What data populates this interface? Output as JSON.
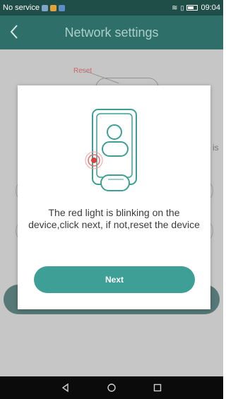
{
  "status": {
    "carrier": "No service",
    "time": "09:04"
  },
  "header": {
    "title": "Network settings"
  },
  "background": {
    "reset_label": "Reset",
    "partial_text": "is"
  },
  "modal": {
    "message": "The red light is blinking on the device,click next, if not,reset the device",
    "next_label": "Next",
    "accent_color": "#3d9f96",
    "indicator_color": "#e23b3b"
  },
  "icons": {
    "back": "chevron-left-icon",
    "back_nav": "triangle-back-icon",
    "home_nav": "circle-home-icon",
    "recents_nav": "square-recents-icon"
  }
}
